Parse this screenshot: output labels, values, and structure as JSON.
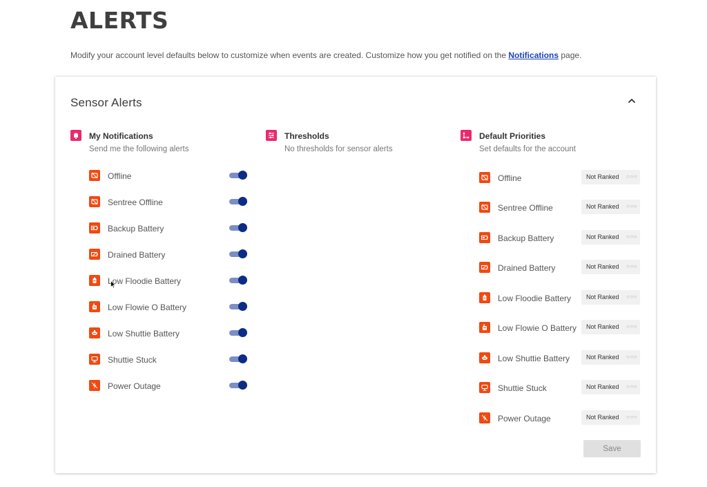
{
  "page": {
    "title": "ALERTS",
    "intro_text": "Modify your account level defaults below to customize when events are created. Customize how you get notified on the ",
    "intro_link": "Notifications",
    "intro_suffix": " page."
  },
  "card": {
    "title": "Sensor Alerts",
    "collapse_icon": "chevron-up-icon"
  },
  "columns": {
    "notifications": {
      "title": "My Notifications",
      "subtitle": "Send me the following alerts",
      "icon": "bell-icon"
    },
    "thresholds": {
      "title": "Thresholds",
      "subtitle": "No thresholds for sensor alerts",
      "icon": "sliders-icon"
    },
    "priorities": {
      "title": "Default Priorities",
      "subtitle": "Set defaults for the account",
      "icon": "priority-icon"
    }
  },
  "alerts": [
    {
      "label": "Offline",
      "icon": "offline-icon",
      "enabled": true,
      "priority": "Not Ranked"
    },
    {
      "label": "Sentree Offline",
      "icon": "sentree-offline-icon",
      "enabled": true,
      "priority": "Not Ranked"
    },
    {
      "label": "Backup Battery",
      "icon": "backup-battery-icon",
      "enabled": true,
      "priority": "Not Ranked"
    },
    {
      "label": "Drained Battery",
      "icon": "drained-battery-icon",
      "enabled": true,
      "priority": "Not Ranked"
    },
    {
      "label": "Low Floodie Battery",
      "icon": "floodie-icon",
      "enabled": true,
      "priority": "Not Ranked"
    },
    {
      "label": "Low Flowie O Battery",
      "icon": "flowie-icon",
      "enabled": true,
      "priority": "Not Ranked"
    },
    {
      "label": "Low Shuttie Battery",
      "icon": "shuttie-icon",
      "enabled": true,
      "priority": "Not Ranked"
    },
    {
      "label": "Shuttie Stuck",
      "icon": "shuttie-stuck-icon",
      "enabled": true,
      "priority": "Not Ranked"
    },
    {
      "label": "Power Outage",
      "icon": "power-outage-icon",
      "enabled": true,
      "priority": "Not Ranked"
    }
  ],
  "rank_dots": "○○○",
  "save_label": "Save",
  "colors": {
    "accent_pink": "#ea2a6e",
    "alert_orange": "#ef4a12",
    "toggle_on": "#0d2c86",
    "link": "#1a44b8"
  }
}
